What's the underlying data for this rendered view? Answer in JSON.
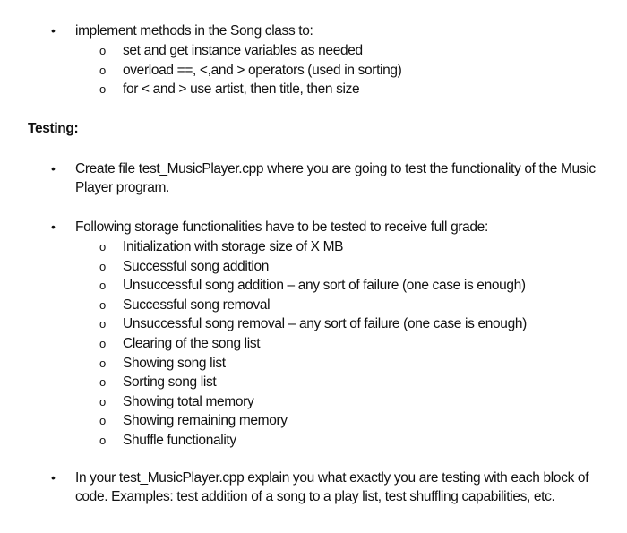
{
  "section1": {
    "bullet_symbol": "•",
    "text": "implement methods in the Song class to:",
    "sub_bullet_symbol": "o",
    "sub_items": [
      "set and get instance variables as needed",
      "overload ==, <,and > operators (used in sorting)",
      "for < and > use artist, then title, then size"
    ]
  },
  "testing": {
    "heading": "Testing:",
    "bullet_symbol": "•",
    "items": [
      {
        "text": "Create file test_MusicPlayer.cpp where you are going to test the functionality of the Music Player program."
      },
      {
        "text": "Following storage functionalities have to be tested to receive full grade:",
        "sub_bullet_symbol": "o",
        "sub_items": [
          "Initialization with storage size of X MB",
          "Successful song addition",
          "Unsuccessful song addition – any sort of failure (one case is enough)",
          "Successful song removal",
          "Unsuccessful song removal – any sort of failure (one case is enough)",
          "Clearing of the song list",
          "Showing song list",
          "Sorting song list",
          "Showing total memory",
          "Showing remaining memory",
          "Shuffle functionality"
        ]
      },
      {
        "text": "In your test_MusicPlayer.cpp explain you what exactly you are testing with each block of code. Examples: test addition of a song to a play list, test shuffling capabilities, etc."
      }
    ]
  }
}
